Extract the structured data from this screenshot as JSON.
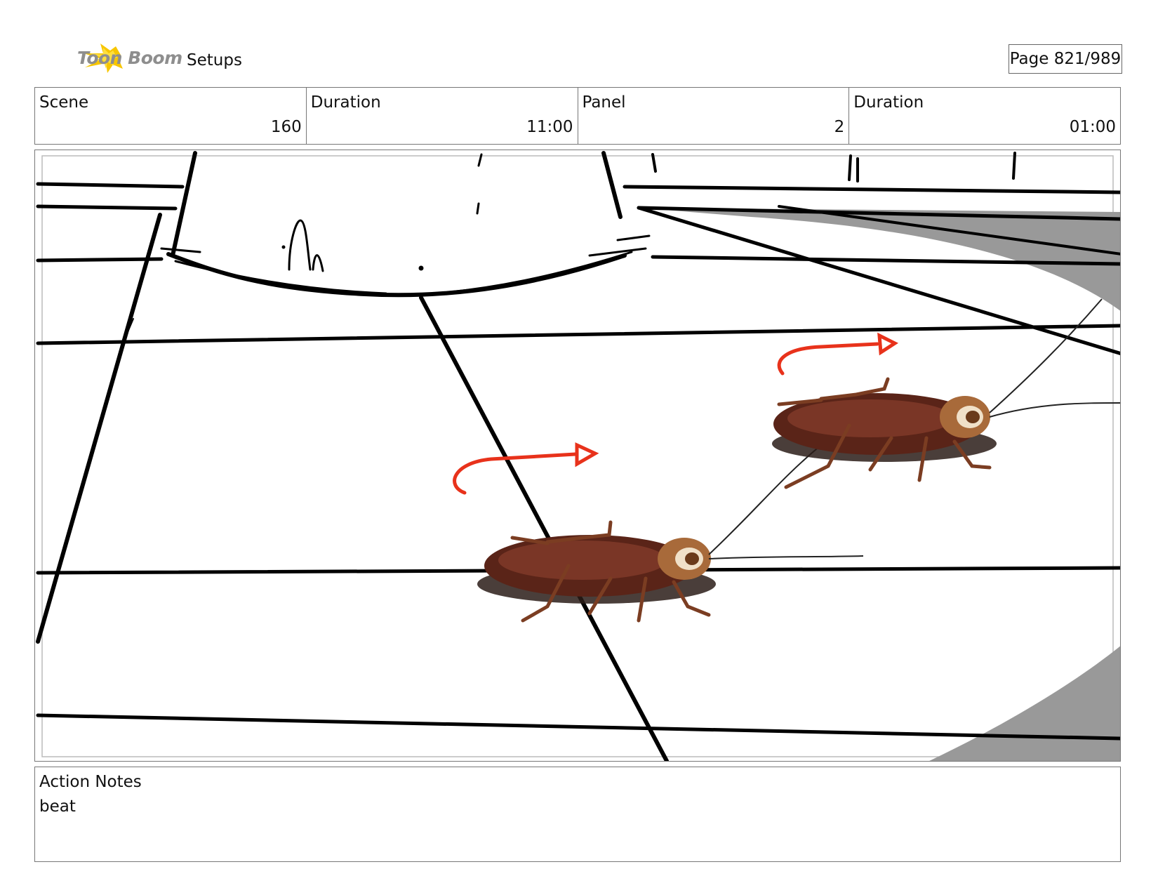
{
  "header": {
    "logo_text": "Toon Boom",
    "section_title": "Setups",
    "page_indicator": "Page 821/989"
  },
  "info": {
    "scene_label": "Scene",
    "scene_value": "160",
    "scene_duration_label": "Duration",
    "scene_duration_value": "11:00",
    "panel_label": "Panel",
    "panel_value": "2",
    "panel_duration_label": "Duration",
    "panel_duration_value": "01:00"
  },
  "notes": {
    "label": "Action Notes",
    "text": "beat"
  },
  "colors": {
    "arrow": "#e8321b",
    "shadow_gray": "#9a9a9a",
    "roach_body": "#5a2418"
  }
}
